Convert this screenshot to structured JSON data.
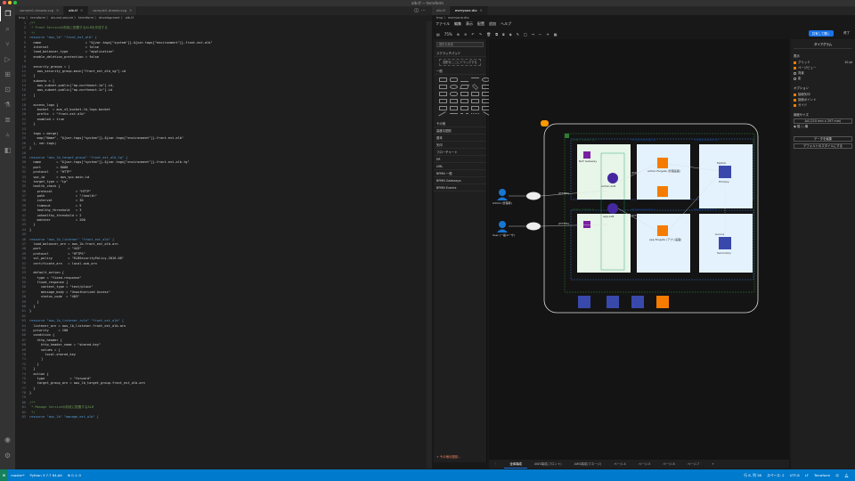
{
  "window": {
    "title": "alb.tf — terraform"
  },
  "vscode": {
    "tabs": [
      {
        "label": "sample1.drawio.svg",
        "active": false
      },
      {
        "label": "alb.tf",
        "active": true
      },
      {
        "label": "sample2.drawio.svg",
        "active": false
      }
    ],
    "breadcrumb": "tmp 〉 terraform 〉 aiz-est-secure 〉 terraform 〉 development 〉 alb.tf",
    "code_lines": [
      "/**",
      " * Front Serviceの前段に配置するALBを作成する",
      " */",
      "resource \"aws_lb\" \"front_est_alb\" {",
      "  name                       = \"${var.tags[\"system\"]}-${var.tags[\"environment\"]}-front-est-alb\"",
      "  internal                   = false",
      "  load_balancer_type         = \"application\"",
      "  enable_deletion_protection = false",
      "",
      "  security_groups = [",
      "    aws_security_group.main[\"front_est_alb_sg\"].id",
      "  ]",
      "  subnets = [",
      "    aws_subnet.public[\"ap-northeast-1a\"].id,",
      "    aws_subnet.public[\"ap-northeast-1c\"].id",
      "  ]",
      "",
      "  access_logs {",
      "    bucket  = aws_s3_bucket.lb_logs.bucket",
      "    prefix  = \"front-est-alb\"",
      "    enabled = true",
      "  }",
      "",
      "  tags = merge(",
      "    map(\"Name\", \"${var.tags[\"system\"]}-${var.tags[\"environment\"]}-front-est-alb\"",
      "  ), var.tags)",
      "}",
      "",
      "resource \"aws_lb_target_group\" \"front_est_alb_tg\" {",
      "  name        = \"${var.tags[\"system\"]}-${var.tags[\"environment\"]}-front-est-alb-tg\"",
      "  port        = 8080",
      "  protocol    = \"HTTP\"",
      "  vpc_id      = aws_vpc.main.id",
      "  target_type = \"ip\"",
      "  health_check {",
      "    protocol            = \"HTTP\"",
      "    path                = \"/health\"",
      "    interval            = 30",
      "    timeout             = 5",
      "    healthy_threshold   = 3",
      "    unhealthy_threshold = 2",
      "    matcher             = 200",
      "  }",
      "}",
      "",
      "resource \"aws_lb_listener\" \"front_est_alb\" {",
      "  load_balancer_arn = aws_lb.front_est_alb.arn",
      "  port              = \"443\"",
      "  protocol          = \"HTTPS\"",
      "  ssl_policy        = \"ELBSecurityPolicy-2016-08\"",
      "  certificate_arn   = local.acm_arn",
      "",
      "  default_action {",
      "    type = \"fixed-response\"",
      "    fixed_response {",
      "      content_type = \"text/plain\"",
      "      message_body = \"Unauthorized Access\"",
      "      status_code  = \"403\"",
      "    }",
      "  }",
      "}",
      "",
      "resource \"aws_lb_listener_rule\" \"front_est_alb\" {",
      "  listener_arn = aws_lb_listener.front_est_alb.arn",
      "  priority     = 100",
      "  condition {",
      "    http_header {",
      "      http_header_name = \"shared-key\"",
      "      values = [",
      "        local.shared_key",
      "      ]",
      "    }",
      "  }",
      "  action {",
      "    type             = \"forward\"",
      "    target_group_arn = aws_lb_target_group.front_est_alb.arn",
      "  }",
      "}",
      "",
      "/**",
      " * Manage Serviceの前段に配置するALB",
      " */",
      "resource \"aws_lb\" \"manage_est_alb\" {"
    ]
  },
  "status": {
    "remote": "⊞",
    "branch": "master*",
    "python": "Python 3.7.7 64-bit",
    "problems": "⊗ 0 ⚠ 0",
    "position": "行 8, 列 38",
    "spaces": "スペース: 2",
    "encoding": "UTF-8",
    "eol": "LF",
    "language": "Terraform"
  },
  "drawio": {
    "tabs": [
      {
        "label": "alb.tf",
        "active": false
      },
      {
        "label": "everyone.dio",
        "active": true
      }
    ],
    "breadcrumb": "tmp 〉 everyone.dio",
    "menus": [
      "ファイル",
      "編集",
      "表示",
      "配置",
      "追加",
      "ヘルプ"
    ],
    "toolbar": {
      "zoom": "75%"
    },
    "share_label": "共有して開く",
    "save_label": "終了",
    "search_placeholder": "図形を検索",
    "sections": [
      "スクラッチパッド",
      "一般",
      "その他",
      "高度な図形",
      "基本",
      "矢印",
      "フローチャート",
      "ER",
      "UML",
      "BPMN 一般",
      "BPMN Gateways",
      "BPMN Events"
    ],
    "drop_hint": "図形をここにドラッグする",
    "more_shapes": "+ その他の図形...",
    "pages": [
      "全体構成",
      "AWS構成(フロント)",
      "AWS構成(マネージ)",
      "ページ-4",
      "ページ-5",
      "ページ-6",
      "ページ-7"
    ],
    "props": {
      "tab": "ダイアグラム",
      "view_hd": "表示",
      "view_items": [
        "グリッド",
        "ページビュー",
        "背景",
        "影"
      ],
      "grid_size": "10 pt",
      "option_hd": "オプション",
      "option_items": [
        "接続矢印",
        "接続ポイント",
        "ガイド"
      ],
      "paper_hd": "用紙サイズ",
      "paper_value": "A4 (210 mm x 297 mm)",
      "orientation": [
        "縦",
        "横"
      ],
      "btn_edit": "データを編集",
      "btn_default": "デフォルトのスタイルにする"
    },
    "diagram": {
      "users": [
        {
          "label": "Admin (管理者)"
        },
        {
          "label": "User (一般ユーザ)"
        }
      ],
      "subnets": [
        "Public Subnet 1a",
        "Private Subnet 1a",
        "Private Subnet 1a",
        "Public Subnet 1c",
        "Private Subnet 1c",
        "Private Subnet 1c"
      ],
      "services": {
        "alb": "admin-ALB",
        "alb2": "app-ALB",
        "fargate1": "admin-Fargate (管理画面)",
        "fargate2": "app-Fargate (アプリ画面)",
        "rds1": "Primary",
        "rds2": "Secondary",
        "nat": "NAT Gateway"
      },
      "labels": {
        "https": "(HTTPS)",
        "http": "(HTTP)",
        "mysql": "MySQL",
        "aurora": "Aurora"
      }
    }
  }
}
